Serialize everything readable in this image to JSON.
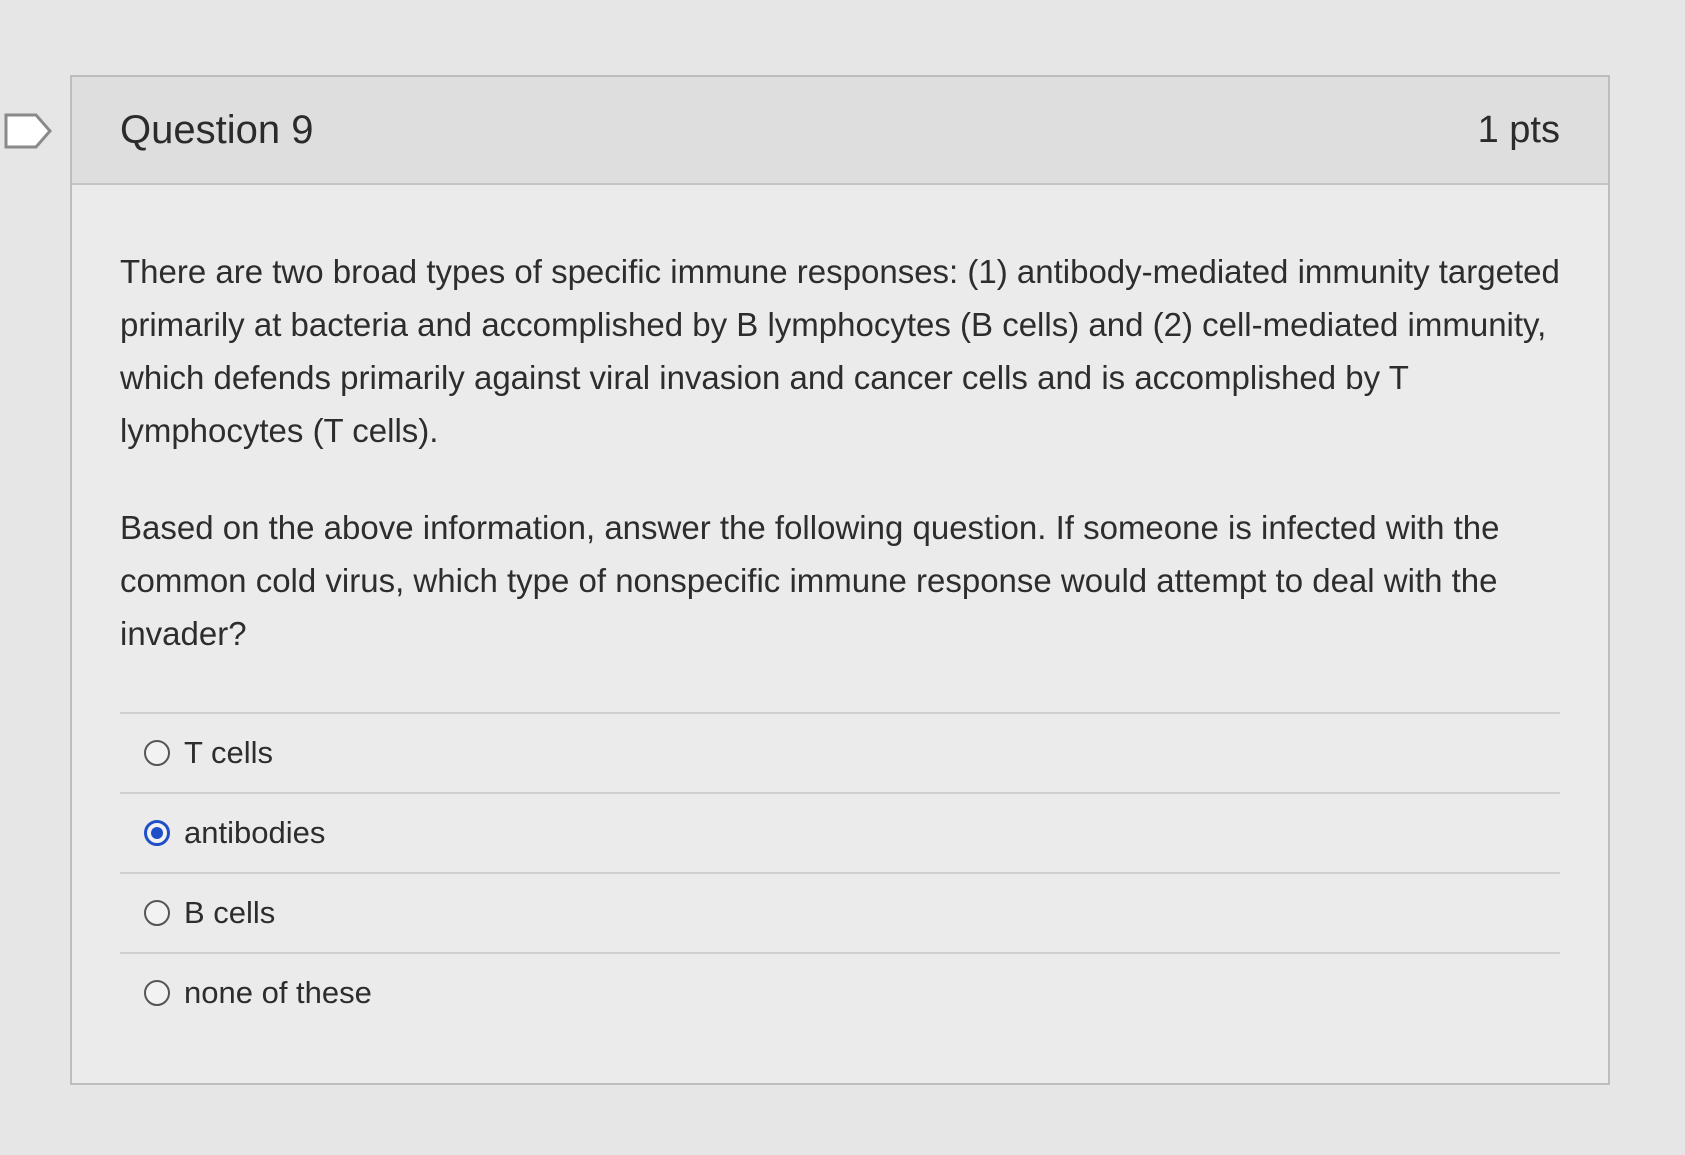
{
  "question": {
    "title": "Question 9",
    "points": "1 pts",
    "paragraphs": [
      "There are two broad types of specific immune responses: (1) antibody-mediated immunity targeted primarily at bacteria and accomplished by B lymphocytes (B cells) and (2) cell-mediated immunity, which defends primarily against viral invasion and cancer cells and is accomplished by T lymphocytes (T cells).",
      "Based on the above information, answer the following question. If someone is infected with the common cold virus, which type of nonspecific immune response would attempt to deal with the invader?"
    ],
    "answers": [
      {
        "label": "T cells",
        "selected": false
      },
      {
        "label": "antibodies",
        "selected": true
      },
      {
        "label": "B cells",
        "selected": false
      },
      {
        "label": "none of these",
        "selected": false
      }
    ]
  },
  "colors": {
    "selected_radio": "#1f4fc9"
  },
  "icons": {
    "flag": "flag-outline-icon"
  }
}
